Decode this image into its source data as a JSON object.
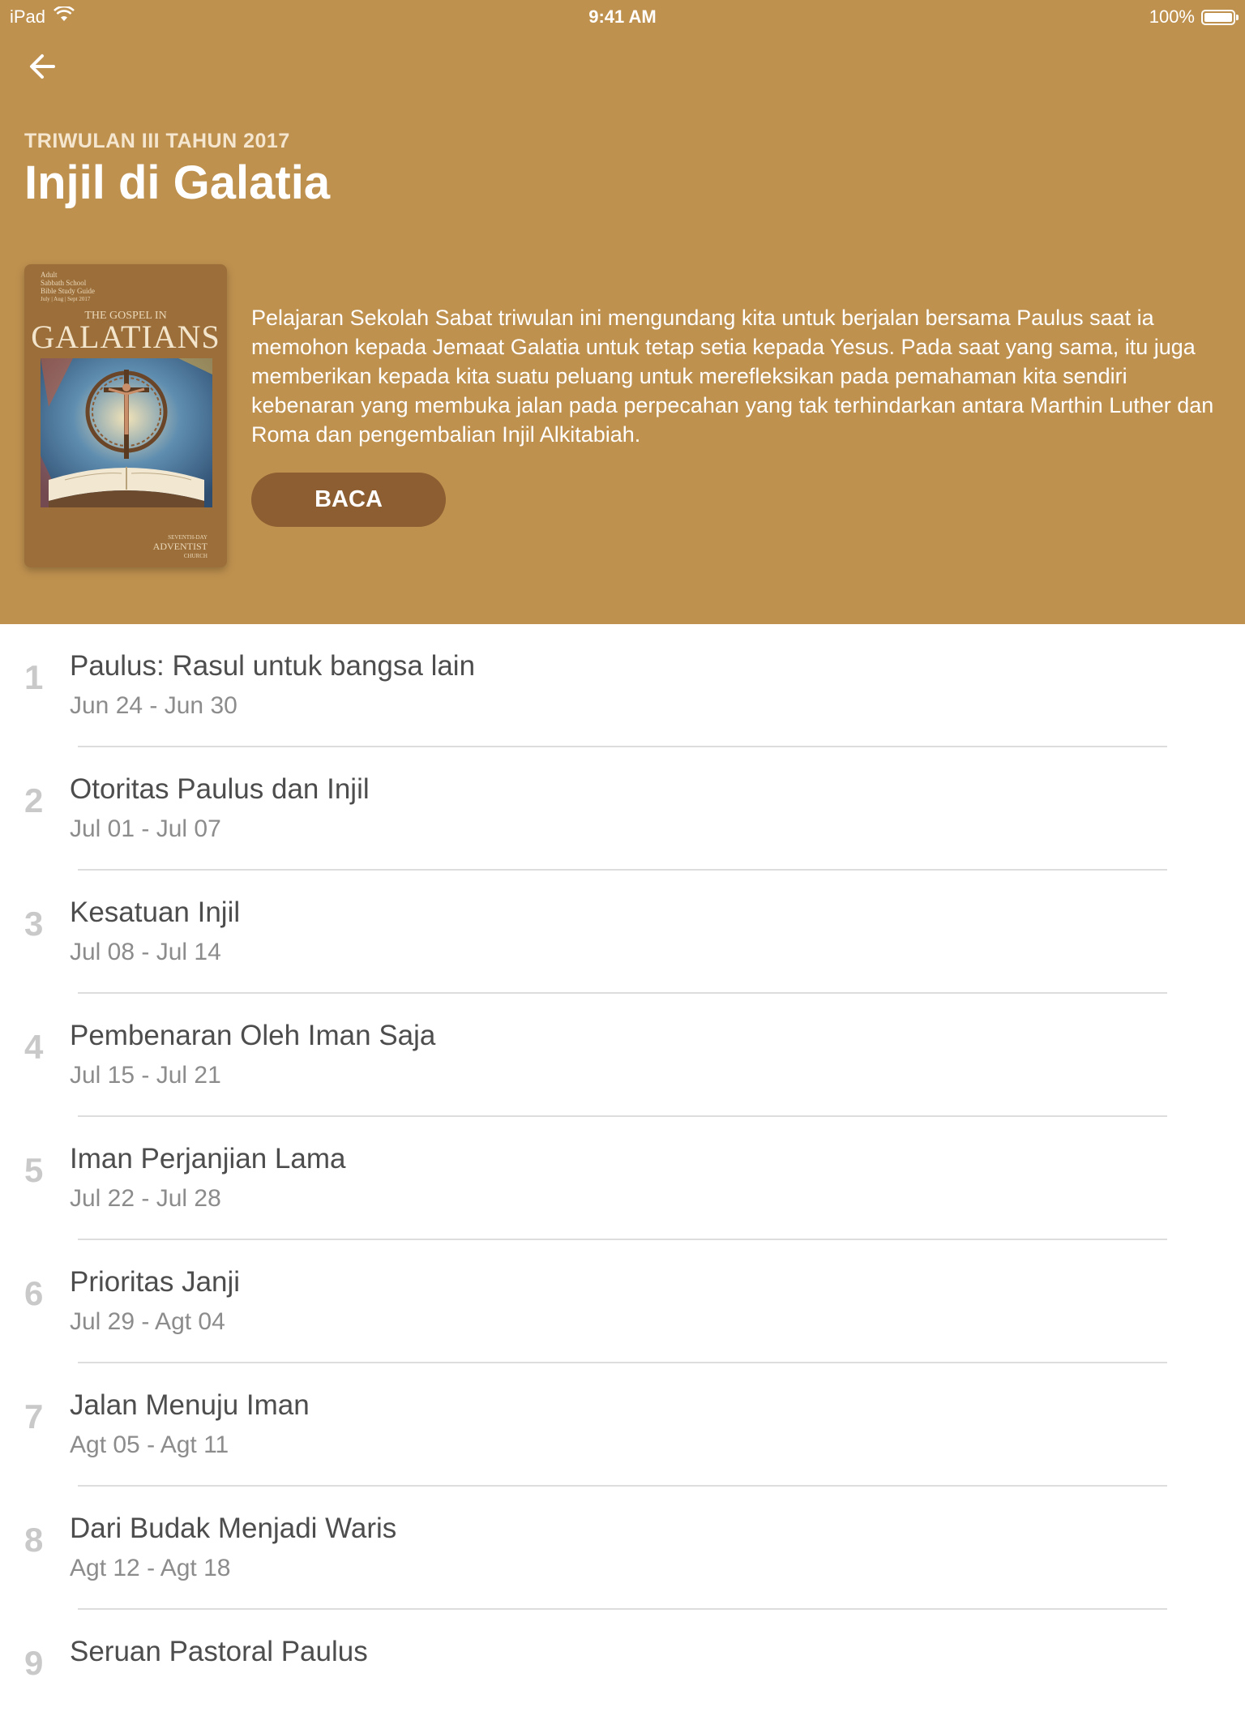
{
  "status_bar": {
    "device": "iPad",
    "time": "9:41 AM",
    "battery": "100%"
  },
  "header": {
    "quarter": "TRIWULAN III TAHUN 2017",
    "title": "Injil di Galatia",
    "description": "Pelajaran Sekolah Sabat triwulan ini mengundang kita untuk berjalan bersama Paulus saat ia memohon kepada Jemaat Galatia untuk tetap setia kepada Yesus. Pada saat yang sama, itu juga memberikan kepada kita suatu peluang untuk merefleksikan pada pemahaman kita sendiri kebenaran yang membuka jalan pada perpecahan yang tak terhindarkan antara Marthin Luther dan Roma dan pengembalian Injil Alkitabiah.",
    "read_button": "BACA",
    "back_icon": "arrow-left-icon"
  },
  "cover": {
    "top_lines": [
      "Adult",
      "Sabbath School",
      "Bible Study Guide",
      "July | Aug | Sept 2017"
    ],
    "subtitle": "THE GOSPEL IN",
    "title": "GALATIANS",
    "publisher_line1": "SEVENTH-DAY",
    "publisher_line2": "ADVENTIST",
    "publisher_line3": "CHURCH"
  },
  "lessons": [
    {
      "num": "1",
      "title": "Paulus: Rasul untuk bangsa lain",
      "dates": "Jun 24 - Jun 30"
    },
    {
      "num": "2",
      "title": "Otoritas Paulus dan Injil",
      "dates": "Jul 01 - Jul 07"
    },
    {
      "num": "3",
      "title": "Kesatuan Injil",
      "dates": "Jul 08 - Jul 14"
    },
    {
      "num": "4",
      "title": "Pembenaran Oleh Iman Saja",
      "dates": "Jul 15 - Jul 21"
    },
    {
      "num": "5",
      "title": "Iman Perjanjian Lama",
      "dates": "Jul 22 - Jul 28"
    },
    {
      "num": "6",
      "title": "Prioritas Janji",
      "dates": "Jul 29 - Agt 04"
    },
    {
      "num": "7",
      "title": "Jalan Menuju Iman",
      "dates": "Agt 05 - Agt 11"
    },
    {
      "num": "8",
      "title": "Dari Budak Menjadi Waris",
      "dates": "Agt 12 - Agt 18"
    },
    {
      "num": "9",
      "title": "Seruan Pastoral Paulus",
      "dates": ""
    }
  ],
  "colors": {
    "header_bg": "#BF914F",
    "button_bg": "#8C5E31"
  }
}
